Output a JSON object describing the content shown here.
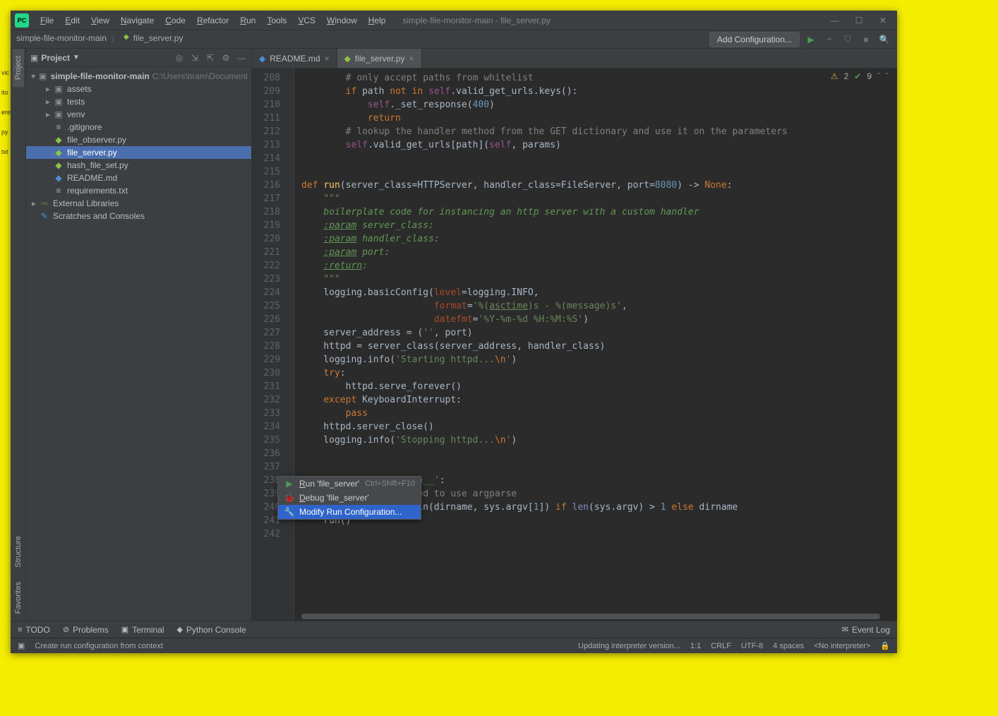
{
  "window_title": "simple-file-monitor-main - file_server.py",
  "menu": [
    "File",
    "Edit",
    "View",
    "Navigate",
    "Code",
    "Refactor",
    "Run",
    "Tools",
    "VCS",
    "Window",
    "Help"
  ],
  "breadcrumb": {
    "project": "simple-file-monitor-main",
    "file": "file_server.py"
  },
  "toolbar": {
    "add_config": "Add Configuration..."
  },
  "project_panel": {
    "title": "Project"
  },
  "tree": {
    "root": {
      "label": "simple-file-monitor-main",
      "path": "C:\\Users\\bram\\Documents\\s"
    },
    "items": [
      {
        "indent": 1,
        "exp": "▸",
        "icon": "folder",
        "label": "assets"
      },
      {
        "indent": 1,
        "exp": "▸",
        "icon": "folder",
        "label": "tests"
      },
      {
        "indent": 1,
        "exp": "▸",
        "icon": "folder",
        "label": "venv"
      },
      {
        "indent": 1,
        "exp": "",
        "icon": "txt",
        "label": ".gitignore"
      },
      {
        "indent": 1,
        "exp": "",
        "icon": "py",
        "label": "file_observer.py"
      },
      {
        "indent": 1,
        "exp": "",
        "icon": "py",
        "label": "file_server.py",
        "selected": true
      },
      {
        "indent": 1,
        "exp": "",
        "icon": "py",
        "label": "hash_file_set.py"
      },
      {
        "indent": 1,
        "exp": "",
        "icon": "md",
        "label": "README.md"
      },
      {
        "indent": 1,
        "exp": "",
        "icon": "txt",
        "label": "requirements.txt"
      }
    ],
    "external": "External Libraries",
    "scratches": "Scratches and Consoles"
  },
  "tabs": [
    {
      "icon": "md",
      "label": "README.md",
      "active": false
    },
    {
      "icon": "py",
      "label": "file_server.py",
      "active": true
    }
  ],
  "inspections": {
    "warnings": "2",
    "ok": "9"
  },
  "context_menu": {
    "run": {
      "label": "Run 'file_server'",
      "shortcut": "Ctrl+Shift+F10"
    },
    "debug": {
      "label": "Debug 'file_server'"
    },
    "modify": {
      "label": "Modify Run Configuration..."
    }
  },
  "bottom_tabs": {
    "todo": "TODO",
    "problems": "Problems",
    "terminal": "Terminal",
    "pyconsole": "Python Console",
    "eventlog": "Event Log"
  },
  "status": {
    "tip": "Create run configuration from context",
    "updating": "Updating interpreter version...",
    "line_col": "1:1",
    "linesep": "CRLF",
    "encoding": "UTF-8",
    "indent": "4 spaces",
    "interp": "<No interpreter>"
  },
  "line_start": 208,
  "line_count": 35
}
